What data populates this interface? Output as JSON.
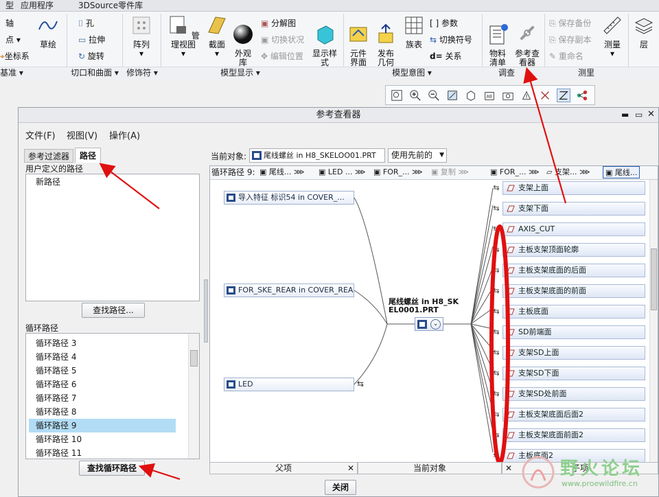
{
  "ribbon_tabs": [
    "型",
    "应用程序",
    "3DSource零件库"
  ],
  "ribbon": {
    "col1": [
      "轴",
      "点",
      "坐标系"
    ],
    "sketch": "草绘",
    "col2": [
      "孔",
      "拉伸",
      "旋转"
    ],
    "array": "阵列",
    "manage_view": "管理视图",
    "section": "截面",
    "appearance": "外观\n库",
    "col3": [
      "分解图",
      "切换状况",
      "编辑位置"
    ],
    "display_style": "显示样\n式",
    "element_ui": "元件\n界面",
    "publish_geom": "发布\n几何",
    "family_table": "族表",
    "col4": [
      "参数",
      "切换符号",
      "关系"
    ],
    "bom": "物料\n清单",
    "ref_viewer": "参考查\n看器",
    "col5": [
      "保存备份",
      "保存副本",
      "重命名"
    ],
    "measure": "测量",
    "layer": "层",
    "groups": [
      "基准",
      "切口和曲面",
      "修饰符",
      "模型显示",
      "模型意图",
      "调查",
      "测里"
    ]
  },
  "dialog": {
    "title": "参考查看器",
    "menus": [
      "文件(F)",
      "视图(V)",
      "操作(A)"
    ],
    "left_tabs": [
      "参考过滤器",
      "路径"
    ],
    "user_paths_label": "用户定义的路径",
    "new_path": "新路径",
    "find_path_btn": "查找路径...",
    "loop_paths_label": "循环路径",
    "loop_paths": [
      "循环路径 3",
      "循环路径 4",
      "循环路径 5",
      "循环路径 6",
      "循环路径 7",
      "循环路径 8",
      "循环路径 9",
      "循环路径 10",
      "循环路径 11"
    ],
    "selected_loop_index": 6,
    "find_loop_btn": "查找循环路径",
    "current_object_label": "当前对象:",
    "current_object_value": "尾线螺丝 in H8_SKELOO01.PRT",
    "use_prev": "使用先前的",
    "path_header": [
      "循环路径 9:",
      "尾线...",
      "LED ...",
      "FOR_...",
      "复制",
      "FOR_...",
      "支架...",
      "尾线..."
    ],
    "parents": [
      "导入特征 标识54 in COVER_...",
      "FOR_SKE_REAR in COVER_REA...",
      "LED"
    ],
    "center_label_1": "尾线螺丝  in H8_SK",
    "center_label_2": "EL0001.PRT",
    "children": [
      "支架上面",
      "支架下面",
      "AXIS_CUT",
      "主板支架顶面轮廓",
      "主板支架底面的后面",
      "主板支架底面的前面",
      "主板底面",
      "SD前端面",
      "支架SD上面",
      "支架SD下面",
      "支架SD处前面",
      "主板支架底面后面2",
      "主板支架底面前面2",
      "主板底面2"
    ],
    "bottom_tabs": [
      "父项",
      "当前对象",
      "子项"
    ],
    "close_btn": "关闭"
  },
  "watermark": {
    "text": "野火论坛",
    "url": "www.proewildfire.cn"
  },
  "colors": {
    "accent": "#b2dcf5",
    "annotation": "#e01010"
  }
}
